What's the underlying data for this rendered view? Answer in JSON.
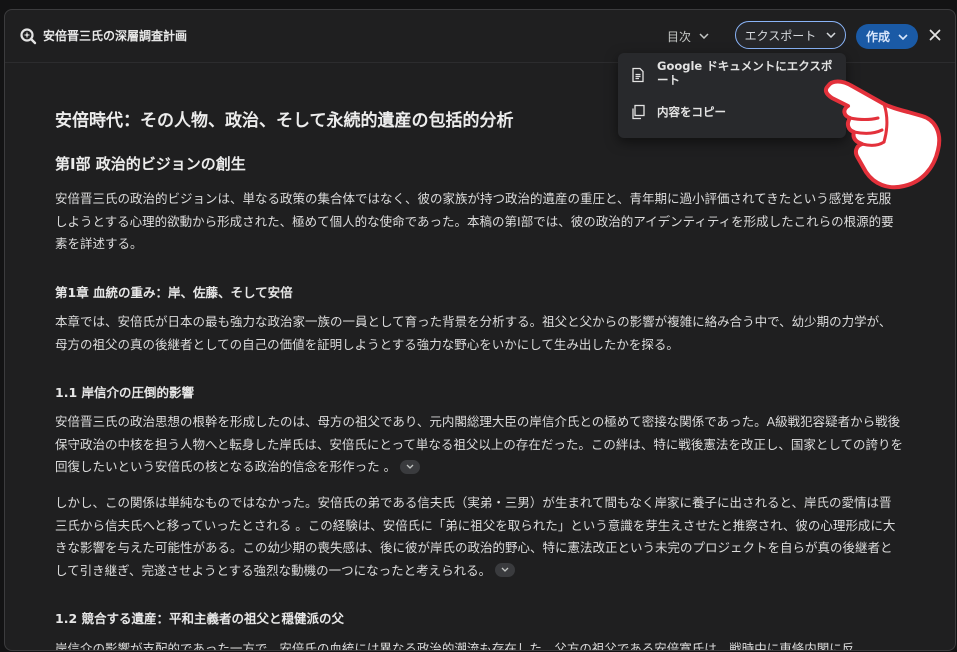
{
  "header": {
    "title": "安倍晋三氏の深層調査計画",
    "toc_label": "目次",
    "export_label": "エクスポート",
    "create_label": "作成"
  },
  "export_menu": {
    "items": [
      {
        "label": "Google ドキュメントにエクスポート",
        "icon": "document-icon"
      },
      {
        "label": "内容をコピー",
        "icon": "copy-icon"
      }
    ]
  },
  "document": {
    "title": "安倍時代：その人物、政治、そして永続的遺産の包括的分析",
    "part1_heading": "第I部 政治的ビジョンの創生",
    "part1_intro": "安倍晋三氏の政治的ビジョンは、単なる政策の集合体ではなく、彼の家族が持つ政治的遺産の重圧と、青年期に過小評価されてきたという感覚を克服しようとする心理的欲動から形成された、極めて個人的な使命であった。本稿の第I部では、彼の政治的アイデンティティを形成したこれらの根源的要素を詳述する。",
    "chapter1_heading": "第1章 血統の重み：岸、佐藤、そして安倍",
    "chapter1_intro": "本章では、安倍氏が日本の最も強力な政治家一族の一員として育った背景を分析する。祖父と父からの影響が複雑に絡み合う中で、幼少期の力学が、母方の祖父の真の後継者としての自己の価値を証明しようとする強力な野心をいかにして生み出したかを探る。",
    "section11_heading": "1.1 岸信介の圧倒的影響",
    "section11_p1": "安倍晋三氏の政治思想の根幹を形成したのは、母方の祖父であり、元内閣総理大臣の岸信介氏との極めて密接な関係であった。A級戦犯容疑者から戦後保守政治の中核を担う人物へと転身した岸氏は、安倍氏にとって単なる祖父以上の存在だった。この絆は、特に戦後憲法を改正し、国家としての誇りを回復したいという安倍氏の核となる政治的信念を形作った 。",
    "section11_p2": "しかし、この関係は単純なものではなかった。安倍氏の弟である信夫氏（実弟・三男）が生まれて間もなく岸家に養子に出されると、岸氏の愛情は晋三氏から信夫氏へと移っていったとされる 。この経験は、安倍氏に「弟に祖父を取られた」という意識を芽生えさせたと推察され、彼の心理形成に大きな影響を与えた可能性がある。この幼少期の喪失感は、後に彼が岸氏の政治的野心、特に憲法改正という未完のプロジェクトを自らが真の後継者として引き継ぎ、完遂させようとする強烈な動機の一つになったと考えられる。",
    "section12_heading": "1.2 競合する遺産：平和主義者の祖父と穏健派の父",
    "section12_p1": "岸信介の影響が支配的であった一方で、安倍氏の血統には異なる政治的潮流も存在した。父方の祖父である安倍寛氏は、戦時中に東條内閣に反"
  }
}
